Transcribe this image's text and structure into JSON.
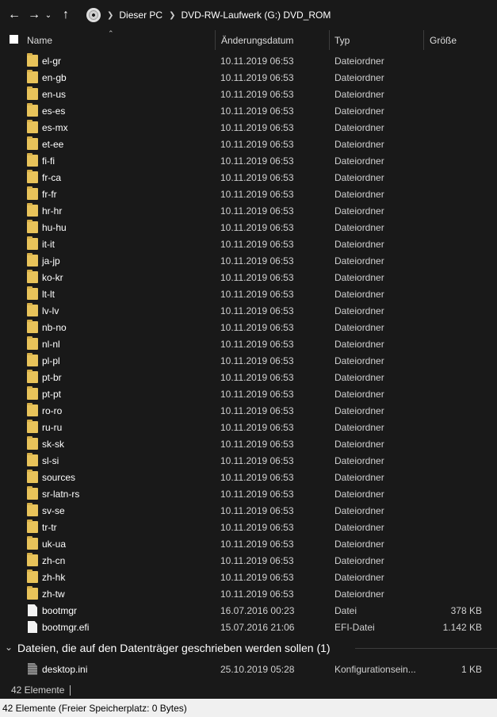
{
  "navbar": {
    "back_icon": "arrow-left-icon",
    "forward_icon": "arrow-right-icon",
    "recent_icon": "chevron-down-icon",
    "up_icon": "arrow-up-icon",
    "drive_icon": "dvd-drive-icon",
    "breadcrumbs": [
      "Dieser PC",
      "DVD-RW-Laufwerk (G:) DVD_ROM"
    ]
  },
  "columns": {
    "name": "Name",
    "date": "Änderungsdatum",
    "type": "Typ",
    "size": "Größe"
  },
  "files": [
    {
      "name": "el-gr",
      "date": "10.11.2019 06:53",
      "type": "Dateiordner",
      "size": "",
      "icon": "folder-icon"
    },
    {
      "name": "en-gb",
      "date": "10.11.2019 06:53",
      "type": "Dateiordner",
      "size": "",
      "icon": "folder-icon"
    },
    {
      "name": "en-us",
      "date": "10.11.2019 06:53",
      "type": "Dateiordner",
      "size": "",
      "icon": "folder-icon"
    },
    {
      "name": "es-es",
      "date": "10.11.2019 06:53",
      "type": "Dateiordner",
      "size": "",
      "icon": "folder-icon"
    },
    {
      "name": "es-mx",
      "date": "10.11.2019 06:53",
      "type": "Dateiordner",
      "size": "",
      "icon": "folder-icon"
    },
    {
      "name": "et-ee",
      "date": "10.11.2019 06:53",
      "type": "Dateiordner",
      "size": "",
      "icon": "folder-icon"
    },
    {
      "name": "fi-fi",
      "date": "10.11.2019 06:53",
      "type": "Dateiordner",
      "size": "",
      "icon": "folder-icon"
    },
    {
      "name": "fr-ca",
      "date": "10.11.2019 06:53",
      "type": "Dateiordner",
      "size": "",
      "icon": "folder-icon"
    },
    {
      "name": "fr-fr",
      "date": "10.11.2019 06:53",
      "type": "Dateiordner",
      "size": "",
      "icon": "folder-icon"
    },
    {
      "name": "hr-hr",
      "date": "10.11.2019 06:53",
      "type": "Dateiordner",
      "size": "",
      "icon": "folder-icon"
    },
    {
      "name": "hu-hu",
      "date": "10.11.2019 06:53",
      "type": "Dateiordner",
      "size": "",
      "icon": "folder-icon"
    },
    {
      "name": "it-it",
      "date": "10.11.2019 06:53",
      "type": "Dateiordner",
      "size": "",
      "icon": "folder-icon"
    },
    {
      "name": "ja-jp",
      "date": "10.11.2019 06:53",
      "type": "Dateiordner",
      "size": "",
      "icon": "folder-icon"
    },
    {
      "name": "ko-kr",
      "date": "10.11.2019 06:53",
      "type": "Dateiordner",
      "size": "",
      "icon": "folder-icon"
    },
    {
      "name": "lt-lt",
      "date": "10.11.2019 06:53",
      "type": "Dateiordner",
      "size": "",
      "icon": "folder-icon"
    },
    {
      "name": "lv-lv",
      "date": "10.11.2019 06:53",
      "type": "Dateiordner",
      "size": "",
      "icon": "folder-icon"
    },
    {
      "name": "nb-no",
      "date": "10.11.2019 06:53",
      "type": "Dateiordner",
      "size": "",
      "icon": "folder-icon"
    },
    {
      "name": "nl-nl",
      "date": "10.11.2019 06:53",
      "type": "Dateiordner",
      "size": "",
      "icon": "folder-icon"
    },
    {
      "name": "pl-pl",
      "date": "10.11.2019 06:53",
      "type": "Dateiordner",
      "size": "",
      "icon": "folder-icon"
    },
    {
      "name": "pt-br",
      "date": "10.11.2019 06:53",
      "type": "Dateiordner",
      "size": "",
      "icon": "folder-icon"
    },
    {
      "name": "pt-pt",
      "date": "10.11.2019 06:53",
      "type": "Dateiordner",
      "size": "",
      "icon": "folder-icon"
    },
    {
      "name": "ro-ro",
      "date": "10.11.2019 06:53",
      "type": "Dateiordner",
      "size": "",
      "icon": "folder-icon"
    },
    {
      "name": "ru-ru",
      "date": "10.11.2019 06:53",
      "type": "Dateiordner",
      "size": "",
      "icon": "folder-icon"
    },
    {
      "name": "sk-sk",
      "date": "10.11.2019 06:53",
      "type": "Dateiordner",
      "size": "",
      "icon": "folder-icon"
    },
    {
      "name": "sl-si",
      "date": "10.11.2019 06:53",
      "type": "Dateiordner",
      "size": "",
      "icon": "folder-icon"
    },
    {
      "name": "sources",
      "date": "10.11.2019 06:53",
      "type": "Dateiordner",
      "size": "",
      "icon": "folder-icon"
    },
    {
      "name": "sr-latn-rs",
      "date": "10.11.2019 06:53",
      "type": "Dateiordner",
      "size": "",
      "icon": "folder-icon"
    },
    {
      "name": "sv-se",
      "date": "10.11.2019 06:53",
      "type": "Dateiordner",
      "size": "",
      "icon": "folder-icon"
    },
    {
      "name": "tr-tr",
      "date": "10.11.2019 06:53",
      "type": "Dateiordner",
      "size": "",
      "icon": "folder-icon"
    },
    {
      "name": "uk-ua",
      "date": "10.11.2019 06:53",
      "type": "Dateiordner",
      "size": "",
      "icon": "folder-icon"
    },
    {
      "name": "zh-cn",
      "date": "10.11.2019 06:53",
      "type": "Dateiordner",
      "size": "",
      "icon": "folder-icon"
    },
    {
      "name": "zh-hk",
      "date": "10.11.2019 06:53",
      "type": "Dateiordner",
      "size": "",
      "icon": "folder-icon"
    },
    {
      "name": "zh-tw",
      "date": "10.11.2019 06:53",
      "type": "Dateiordner",
      "size": "",
      "icon": "folder-icon"
    },
    {
      "name": "bootmgr",
      "date": "16.07.2016 00:23",
      "type": "Datei",
      "size": "378 KB",
      "icon": "file-icon"
    },
    {
      "name": "bootmgr.efi",
      "date": "15.07.2016 21:06",
      "type": "EFI-Datei",
      "size": "1.142 KB",
      "icon": "file-icon"
    }
  ],
  "group": {
    "chevron_icon": "chevron-down-icon",
    "title": "Dateien, die auf den Datenträger geschrieben werden sollen (1)",
    "files": [
      {
        "name": "desktop.ini",
        "date": "25.10.2019 05:28",
        "type": "Konfigurationsein...",
        "size": "1 KB",
        "icon": "ini-file-icon"
      }
    ]
  },
  "status": {
    "count": "42 Elemente",
    "bottom": "42 Elemente (Freier Speicherplatz: 0 Bytes)"
  }
}
